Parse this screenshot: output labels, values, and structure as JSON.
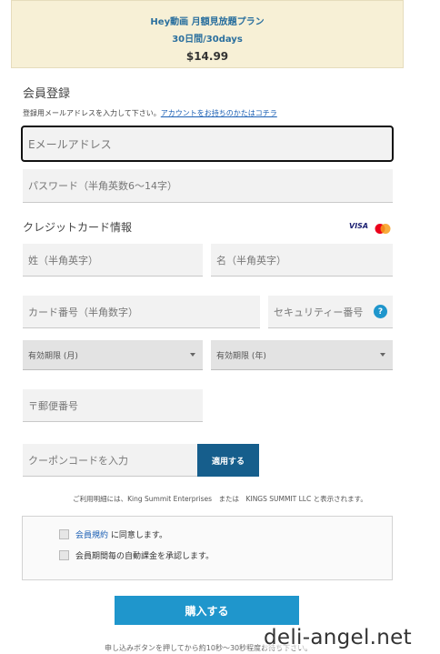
{
  "plan": {
    "name": "Hey動画 月額見放題プラン",
    "period": "30日間/30days",
    "price": "$14.99"
  },
  "registration": {
    "title": "会員登録",
    "helper_text": "登録用メールアドレスを入力して下さい。",
    "login_link": "アカウントをお持ちのかたはコチラ",
    "email_placeholder": "Eメールアドレス",
    "password_placeholder": "パスワード（半角英数6～14字）"
  },
  "card": {
    "title": "クレジットカード情報",
    "brands": [
      "VISA",
      "Mastercard"
    ],
    "last_name_placeholder": "姓（半角英字）",
    "first_name_placeholder": "名（半角英字）",
    "number_placeholder": "カード番号（半角数字）",
    "security_placeholder": "セキュリティー番号",
    "help_icon": "?",
    "exp_month_label": "有効期限 (月)",
    "exp_year_label": "有効期限 (年)",
    "postal_placeholder": "〒郵便番号"
  },
  "coupon": {
    "placeholder": "クーポンコードを入力",
    "apply_label": "適用する"
  },
  "billing_notice": "ご利用明細には、King Summit Enterprises　または　KINGS SUMMIT LLC と表示されます。",
  "agreements": {
    "terms_link": "会員規約",
    "terms_suffix": " に同意します。",
    "auto_billing": "会員期間毎の自動課金を承認します。"
  },
  "buy_button": "購入する",
  "footnote": "申し込みボタンを押してから約10秒～30秒程度お待ち下さい。",
  "watermark": "deli-angel.net",
  "colors": {
    "plan_bg": "#f7f0d6",
    "accent_blue": "#1f96cc",
    "apply_blue": "#165e8c",
    "link_blue": "#1a5fb4"
  }
}
